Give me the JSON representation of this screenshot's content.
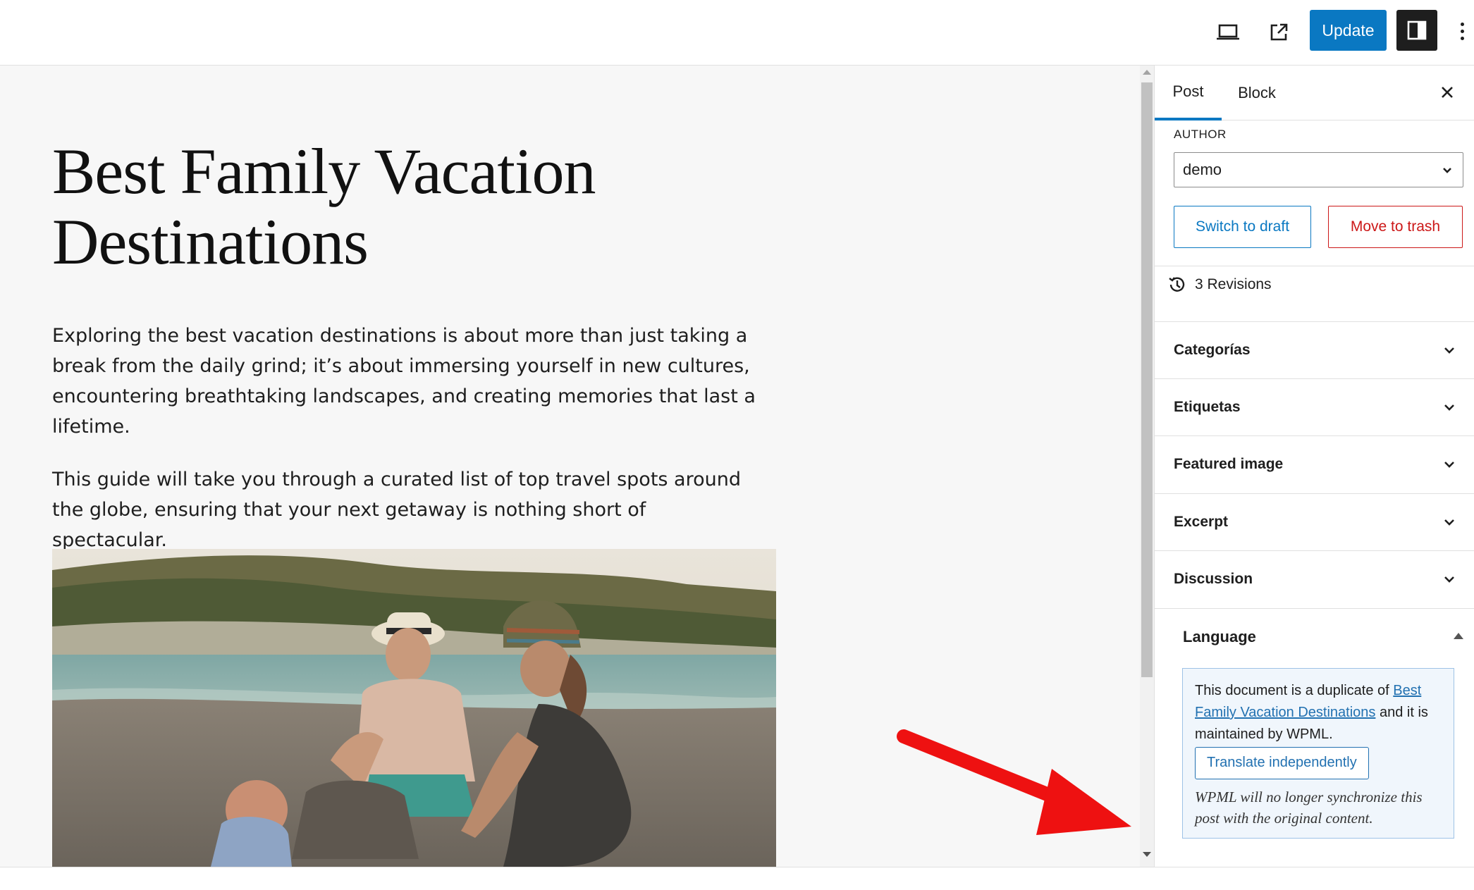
{
  "toolbar": {
    "icons": [
      "device-preview-icon",
      "external-link-icon",
      "sidebar-toggle-icon",
      "more-options-icon"
    ],
    "update_label": "Update",
    "accent_color": "#0a78c2"
  },
  "post": {
    "title": "Best Family Vacation Destinations",
    "paragraphs": [
      "Exploring the best vacation destinations is about more than just taking a break from the daily grind; it’s about immersing yourself in new cultures, encountering breathtaking landscapes, and creating memories that last a lifetime.",
      "This guide will take you through a curated list of top travel spots around the globe, ensuring that your next getaway is nothing short of spectacular."
    ]
  },
  "sidebar": {
    "tabs": [
      {
        "label": "Post",
        "active": true
      },
      {
        "label": "Block",
        "active": false
      }
    ],
    "author_label": "AUTHOR",
    "author_value": "demo",
    "switch_to_draft_label": "Switch to draft",
    "move_to_trash_label": "Move to trash",
    "revisions_label": "3 Revisions",
    "panels": [
      {
        "label": "Categorías"
      },
      {
        "label": "Etiquetas"
      },
      {
        "label": "Featured image"
      },
      {
        "label": "Excerpt"
      },
      {
        "label": "Discussion"
      }
    ],
    "language": {
      "header": "Language",
      "notice_prefix": "This document is a duplicate of ",
      "notice_link": "Best Family Vacation Destinations",
      "notice_suffix": " and it is maintained by WPML.",
      "translate_button": "Translate independently",
      "notice_note": "WPML will no longer synchronize this post with the original content."
    }
  },
  "colors": {
    "danger": "#cc1818",
    "arrow": "#ee1111",
    "notice_bg": "#f0f6fc"
  }
}
